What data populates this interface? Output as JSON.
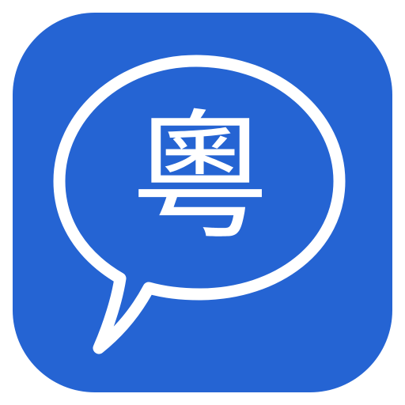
{
  "icon": {
    "name": "speech-bubble-app-icon",
    "character": "粵",
    "colors": {
      "background": "#2564d3",
      "foreground": "#ffffff"
    }
  }
}
